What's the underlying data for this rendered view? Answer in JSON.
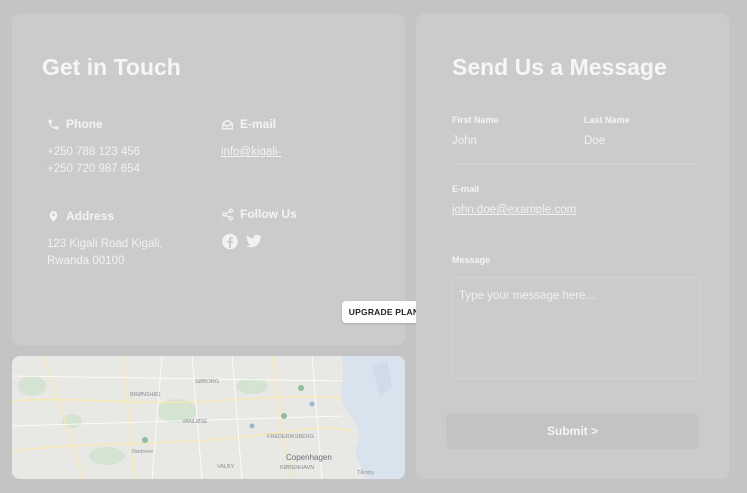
{
  "contact": {
    "title": "Get in Touch",
    "phone": {
      "label": "Phone",
      "line1": "+250 788 123 456",
      "line2": "+250 720 987 654"
    },
    "email": {
      "label": "E-mail",
      "value": "info@kigali-"
    },
    "address": {
      "label": "Address",
      "line1": "123 Kigali Road Kigali,",
      "line2": "Rwanda 00100"
    },
    "follow": {
      "label": "Follow Us",
      "icons": [
        "facebook-icon",
        "twitter-icon"
      ]
    }
  },
  "map": {
    "labels": [
      "Copenhagen",
      "KØBENHAVN",
      "FREDERIKSBERG",
      "VALBY",
      "SØBORG",
      "VANLØSE",
      "Rødovre",
      "BRØNSHØJ",
      "Tårnby"
    ]
  },
  "badge": {
    "label": "UPGRADE PLAN"
  },
  "form": {
    "title": "Send Us a Message",
    "first_name": {
      "label": "First Name",
      "value": "John"
    },
    "last_name": {
      "label": "Last Name",
      "value": "Doe"
    },
    "email": {
      "label": "E-mail",
      "value": "john.doe@example.com"
    },
    "message": {
      "label": "Message",
      "placeholder": "Type your message here..."
    },
    "submit_label": "Submit >"
  },
  "colors": {
    "background": "#c4c4c4",
    "card": "#cbcbcb",
    "text": "#f4f4f4"
  }
}
